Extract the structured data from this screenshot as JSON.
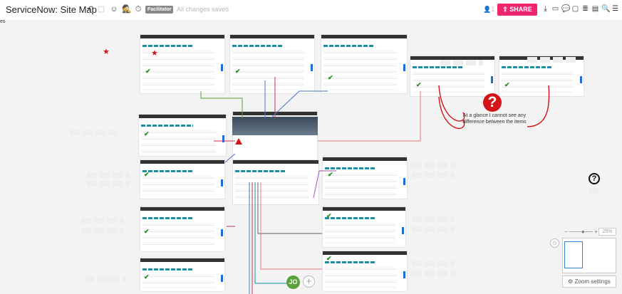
{
  "toolbar": {
    "title": "ServiceNow: Site Map",
    "facilitator_label": "Facilitator",
    "save_status": "All changes saved",
    "user_count": "1",
    "share_label": "SHARE"
  },
  "sidebar_fragment": "es",
  "canvas": {
    "callout_text": "At a glance I cannot see any difference between the items",
    "help_glyph": "?",
    "callout_glyph": "?"
  },
  "zoom": {
    "percent": "25%",
    "settings_label": "Zoom settings",
    "minus": "−",
    "plus": "+"
  },
  "collab": {
    "avatar_initials": "JO"
  },
  "colors": {
    "accent": "#f0246f",
    "alert": "#d3141b",
    "check": "#1e8f1e",
    "link": "#1a8fa8"
  }
}
